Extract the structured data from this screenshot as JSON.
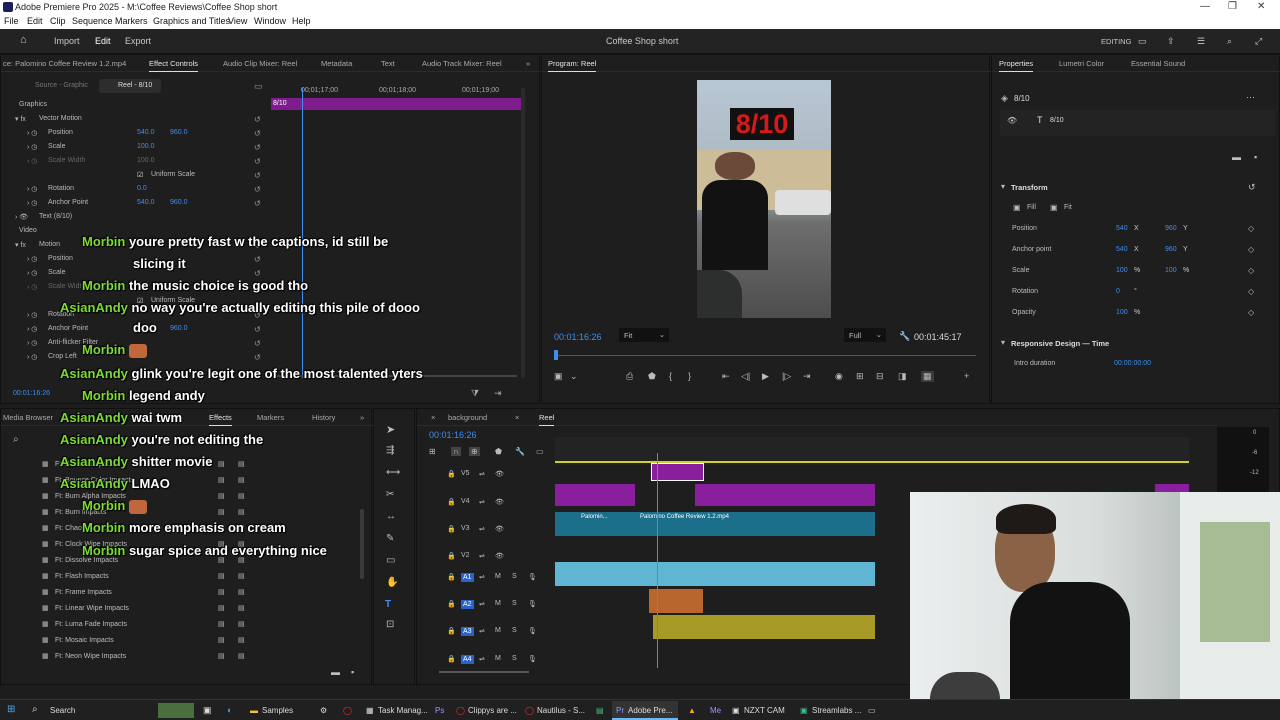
{
  "window": {
    "title": "Adobe Premiere Pro 2025 - M:\\Coffee Reviews\\Coffee Shop short"
  },
  "menu": [
    "File",
    "Edit",
    "Clip",
    "Sequence",
    "Markers",
    "Graphics and Titles",
    "View",
    "Window",
    "Help"
  ],
  "header": {
    "import": "Import",
    "edit": "Edit",
    "export": "Export",
    "project": "Coffee Shop short",
    "mode": "EDITING"
  },
  "effect_controls": {
    "tabs": [
      "ce: Palomino Coffee Review 1.2.mp4",
      "Effect Controls",
      "Audio Clip Mixer: Reel",
      "Metadata",
      "Text",
      "Audio Track Mixer: Reel"
    ],
    "source_tab": "Source - Graphic",
    "reel_tab": "Reel - 8/10",
    "times": [
      "00;01;17;00",
      "00;01;18;00",
      "00;01;19;00"
    ],
    "clip_label": "8/10",
    "rows": {
      "graphics": "Graphics",
      "vector_motion": "Vector Motion",
      "position": "Position",
      "pos_x": "540.0",
      "pos_y": "960.0",
      "scale": "Scale",
      "scale_v": "100.0",
      "scale_width": "Scale Width",
      "scale_w_v": "100.0",
      "uniform": "Uniform Scale",
      "rotation": "Rotation",
      "rot_v": "0.0",
      "anchor": "Anchor Point",
      "anc_x": "540.0",
      "anc_y": "960.0",
      "text": "Text (8/10)",
      "video": "Video",
      "motion": "Motion",
      "position2": "Position",
      "scale2": "Scale",
      "scale_width2": "Scale Width",
      "uniform2": "Uniform Scale",
      "rotation2": "Rotation",
      "anchor2": "Anchor Point",
      "anc2_y": "960.0",
      "antiflicker": "Anti-flicker Filter",
      "crop_left": "Crop Left"
    },
    "timecode": "00:01:16:26"
  },
  "program": {
    "title": "Program: Reel",
    "overlay": "8/10",
    "timecode": "00:01:16:26",
    "fit": "Fit",
    "full": "Full",
    "duration": "00:01:45:17"
  },
  "properties": {
    "tabs": [
      "Properties",
      "Lumetri Color",
      "Essential Sound"
    ],
    "layer": "8/10",
    "text_layer": "8/10",
    "transform": "Transform",
    "fill": "Fill",
    "fit": "Fit",
    "rows": [
      {
        "label": "Position",
        "x": "540",
        "xs": "X",
        "y": "960",
        "ys": "Y"
      },
      {
        "label": "Anchor point",
        "x": "540",
        "xs": "X",
        "y": "960",
        "ys": "Y"
      },
      {
        "label": "Scale",
        "x": "100",
        "xs": "%",
        "y": "100",
        "ys": "%"
      },
      {
        "label": "Rotation",
        "x": "0",
        "xs": "°",
        "y": "",
        "ys": ""
      },
      {
        "label": "Opacity",
        "x": "100",
        "xs": "%",
        "y": "",
        "ys": ""
      }
    ],
    "responsive": "Responsive Design — Time",
    "intro": "Intro duration",
    "intro_v": "00:00:00:00"
  },
  "effects_panel": {
    "tabs": [
      "Media Browser",
      "Effects",
      "Markers",
      "History"
    ],
    "items": [
      "Ft: Bounce Impacts",
      "Ft: Bounce Color Impacts",
      "Ft: Burn Alpha Impacts",
      "Ft: Burn Impacts",
      "Ft: Chaos Impacts",
      "Ft: Clock Wipe Impacts",
      "Ft: Dissolve Impacts",
      "Ft: Flash Impacts",
      "Ft: Frame Impacts",
      "Ft: Linear Wipe Impacts",
      "Ft: Luma Fade Impacts",
      "Ft: Mosaic Impacts",
      "Ft: Neon Wipe Impacts"
    ]
  },
  "timeline": {
    "tabs": [
      "background",
      "Reel"
    ],
    "timecode": "00:01:16:26",
    "tracks": [
      "V5",
      "V4",
      "V3",
      "V2",
      "A1",
      "A2",
      "A3",
      "A4"
    ],
    "clip1": "Palomin...",
    "clip2": "Palomino Coffee Review 1.2.mp4",
    "audio_levels": [
      "0",
      "-6",
      "-12"
    ]
  },
  "chat": [
    {
      "name": "Morbin",
      "msg": "youre pretty fast w the captions, id still be"
    },
    {
      "name": "",
      "msg": "slicing it"
    },
    {
      "name": "Morbin",
      "msg": "the music choice is good tho"
    },
    {
      "name": "AsianAndy",
      "msg": "no way you're actually editing this pile of dooo"
    },
    {
      "name": "",
      "msg": "doo"
    },
    {
      "name": "Morbin",
      "msg": ""
    },
    {
      "name": "AsianAndy",
      "msg": "glink you're legit one of the most talented yters"
    },
    {
      "name": "Morbin",
      "msg": "legend andy"
    },
    {
      "name": "AsianAndy",
      "msg": "wai twm"
    },
    {
      "name": "AsianAndy",
      "msg": "you're not editing the"
    },
    {
      "name": "AsianAndy",
      "msg": "shitter movie"
    },
    {
      "name": "AsianAndy",
      "msg": "LMAO"
    },
    {
      "name": "Morbin",
      "msg": ""
    },
    {
      "name": "Morbin",
      "msg": "more emphasis on cream"
    },
    {
      "name": "Morbin",
      "msg": "sugar spice and everything nice"
    }
  ],
  "taskbar": {
    "search": "Search",
    "apps": [
      "Samples",
      "Task Manag...",
      "Clippys are ...",
      "Nautilus - S...",
      "Adobe Pre...",
      "NZXT CAM",
      "Streamlabs ..."
    ]
  }
}
